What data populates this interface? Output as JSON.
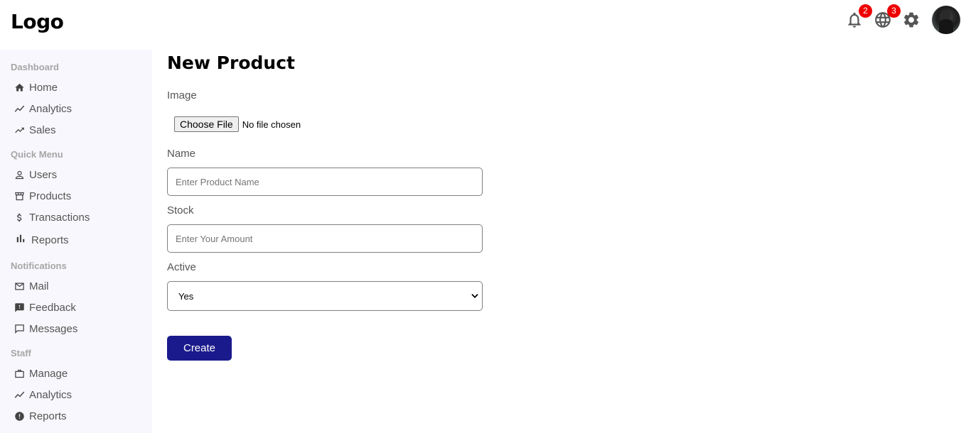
{
  "header": {
    "logo": "Logo",
    "notifications_badge": "2",
    "language_badge": "3"
  },
  "sidebar": {
    "sections": [
      {
        "title": "Dashboard",
        "items": [
          {
            "label": "Home",
            "icon": "home-icon"
          },
          {
            "label": "Analytics",
            "icon": "trend-line-icon"
          },
          {
            "label": "Sales",
            "icon": "trending-up-icon"
          }
        ]
      },
      {
        "title": "Quick Menu",
        "items": [
          {
            "label": "Users",
            "icon": "user-icon"
          },
          {
            "label": "Products",
            "icon": "storefront-icon"
          },
          {
            "label": "Transactions",
            "icon": "dollar-icon"
          },
          {
            "label": "Reports",
            "icon": "bar-chart-icon"
          }
        ]
      },
      {
        "title": "Notifications",
        "items": [
          {
            "label": "Mail",
            "icon": "mail-icon"
          },
          {
            "label": "Feedback",
            "icon": "feedback-icon"
          },
          {
            "label": "Messages",
            "icon": "chat-bubble-icon"
          }
        ]
      },
      {
        "title": "Staff",
        "items": [
          {
            "label": "Manage",
            "icon": "briefcase-icon"
          },
          {
            "label": "Analytics",
            "icon": "trend-line-icon"
          },
          {
            "label": "Reports",
            "icon": "alert-circle-icon"
          }
        ]
      }
    ]
  },
  "form": {
    "title": "New Product",
    "image_label": "Image",
    "file_button": "Choose File",
    "file_status": "No file chosen",
    "name_label": "Name",
    "name_placeholder": "Enter Product Name",
    "stock_label": "Stock",
    "stock_placeholder": "Enter Your Amount",
    "active_label": "Active",
    "active_value": "Yes",
    "submit_label": "Create"
  },
  "colors": {
    "sidebar_bg": "#f7f7fd",
    "primary_button": "#1b1a8c",
    "badge": "#ee0000"
  }
}
